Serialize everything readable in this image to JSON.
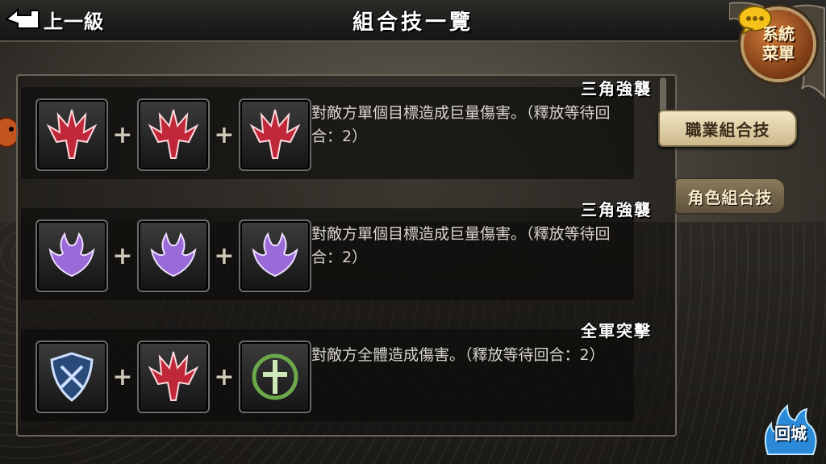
{
  "header": {
    "back_label": "上一級",
    "title": "組合技一覽"
  },
  "system_menu": {
    "label_line1": "系統",
    "label_line2": "菜單"
  },
  "side_tabs": [
    {
      "label": "職業組合技",
      "active": true
    },
    {
      "label": "角色組合技",
      "active": false
    }
  ],
  "combos": [
    {
      "name": "三角強襲",
      "skills": [
        "red-trident-icon",
        "red-trident-icon",
        "red-trident-icon"
      ],
      "description": "對敵方單個目標造成巨量傷害。（釋放等待回合：2）"
    },
    {
      "name": "三角強襲",
      "skills": [
        "purple-flame-icon",
        "purple-flame-icon",
        "purple-flame-icon"
      ],
      "description": "對敵方單個目標造成巨量傷害。（釋放等待回合：2）"
    },
    {
      "name": "全軍突擊",
      "skills": [
        "blue-shield-icon",
        "red-trident-icon",
        "green-cross-icon"
      ],
      "description": "對敵方全體造成傷害。（釋放等待回合：2）"
    }
  ],
  "return_button": {
    "label": "回城"
  },
  "colors": {
    "red_skill": "#c0283a",
    "purple_skill": "#9a6ad8",
    "blue_skill": "#3a7ad8",
    "green_skill": "#6aa84a",
    "tab_active_bg": "#e6d6ac"
  }
}
